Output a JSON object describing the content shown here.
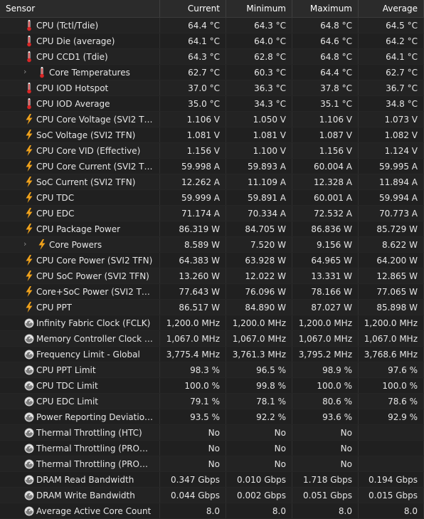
{
  "columns": {
    "sensor": "Sensor",
    "current": "Current",
    "minimum": "Minimum",
    "maximum": "Maximum",
    "average": "Average"
  },
  "rows": [
    {
      "name": "CPU (Tctl/Tdie)",
      "icon": "thermometer-icon",
      "current": "64.4 °C",
      "min": "64.3 °C",
      "max": "64.8 °C",
      "avg": "64.5 °C",
      "group": false
    },
    {
      "name": "CPU Die (average)",
      "icon": "thermometer-icon",
      "current": "64.1 °C",
      "min": "64.0 °C",
      "max": "64.6 °C",
      "avg": "64.2 °C",
      "group": false
    },
    {
      "name": "CPU CCD1 (Tdie)",
      "icon": "thermometer-icon",
      "current": "64.3 °C",
      "min": "62.8 °C",
      "max": "64.8 °C",
      "avg": "64.1 °C",
      "group": false
    },
    {
      "name": "Core Temperatures",
      "icon": "thermometer-icon",
      "current": "62.7 °C",
      "min": "60.3 °C",
      "max": "64.4 °C",
      "avg": "62.7 °C",
      "group": true
    },
    {
      "name": "CPU IOD Hotspot",
      "icon": "thermometer-icon",
      "current": "37.0 °C",
      "min": "36.3 °C",
      "max": "37.8 °C",
      "avg": "36.7 °C",
      "group": false
    },
    {
      "name": "CPU IOD Average",
      "icon": "thermometer-icon",
      "current": "35.0 °C",
      "min": "34.3 °C",
      "max": "35.1 °C",
      "avg": "34.8 °C",
      "group": false
    },
    {
      "name": "CPU Core Voltage (SVI2 TFN)",
      "icon": "lightning-icon",
      "current": "1.106 V",
      "min": "1.050 V",
      "max": "1.106 V",
      "avg": "1.073 V",
      "group": false
    },
    {
      "name": "SoC Voltage (SVI2 TFN)",
      "icon": "lightning-icon",
      "current": "1.081 V",
      "min": "1.081 V",
      "max": "1.087 V",
      "avg": "1.082 V",
      "group": false
    },
    {
      "name": "CPU Core VID (Effective)",
      "icon": "lightning-icon",
      "current": "1.156 V",
      "min": "1.100 V",
      "max": "1.156 V",
      "avg": "1.124 V",
      "group": false
    },
    {
      "name": "CPU Core Current (SVI2 TFN)",
      "icon": "lightning-icon",
      "current": "59.998 A",
      "min": "59.893 A",
      "max": "60.004 A",
      "avg": "59.995 A",
      "group": false
    },
    {
      "name": "SoC Current (SVI2 TFN)",
      "icon": "lightning-icon",
      "current": "12.262 A",
      "min": "11.109 A",
      "max": "12.328 A",
      "avg": "11.894 A",
      "group": false
    },
    {
      "name": "CPU TDC",
      "icon": "lightning-icon",
      "current": "59.999 A",
      "min": "59.891 A",
      "max": "60.001 A",
      "avg": "59.994 A",
      "group": false
    },
    {
      "name": "CPU EDC",
      "icon": "lightning-icon",
      "current": "71.174 A",
      "min": "70.334 A",
      "max": "72.532 A",
      "avg": "70.773 A",
      "group": false
    },
    {
      "name": "CPU Package Power",
      "icon": "lightning-icon",
      "current": "86.319 W",
      "min": "84.705 W",
      "max": "86.836 W",
      "avg": "85.729 W",
      "group": false
    },
    {
      "name": "Core Powers",
      "icon": "lightning-icon",
      "current": "8.589 W",
      "min": "7.520 W",
      "max": "9.156 W",
      "avg": "8.622 W",
      "group": true
    },
    {
      "name": "CPU Core Power (SVI2 TFN)",
      "icon": "lightning-icon",
      "current": "64.383 W",
      "min": "63.928 W",
      "max": "64.965 W",
      "avg": "64.200 W",
      "group": false
    },
    {
      "name": "CPU SoC Power (SVI2 TFN)",
      "icon": "lightning-icon",
      "current": "13.260 W",
      "min": "12.022 W",
      "max": "13.331 W",
      "avg": "12.865 W",
      "group": false
    },
    {
      "name": "Core+SoC Power (SVI2 TFN)",
      "icon": "lightning-icon",
      "current": "77.643 W",
      "min": "76.096 W",
      "max": "78.166 W",
      "avg": "77.065 W",
      "group": false
    },
    {
      "name": "CPU PPT",
      "icon": "lightning-icon",
      "current": "86.517 W",
      "min": "84.890 W",
      "max": "87.027 W",
      "avg": "85.898 W",
      "group": false
    },
    {
      "name": "Infinity Fabric Clock (FCLK)",
      "icon": "gauge-icon",
      "current": "1,200.0 MHz",
      "min": "1,200.0 MHz",
      "max": "1,200.0 MHz",
      "avg": "1,200.0 MHz",
      "group": false
    },
    {
      "name": "Memory Controller Clock (U...",
      "icon": "gauge-icon",
      "current": "1,067.0 MHz",
      "min": "1,067.0 MHz",
      "max": "1,067.0 MHz",
      "avg": "1,067.0 MHz",
      "group": false
    },
    {
      "name": "Frequency Limit - Global",
      "icon": "gauge-icon",
      "current": "3,775.4 MHz",
      "min": "3,761.3 MHz",
      "max": "3,795.2 MHz",
      "avg": "3,768.6 MHz",
      "group": false
    },
    {
      "name": "CPU PPT Limit",
      "icon": "gauge-icon",
      "current": "98.3 %",
      "min": "96.5 %",
      "max": "98.9 %",
      "avg": "97.6 %",
      "group": false
    },
    {
      "name": "CPU TDC Limit",
      "icon": "gauge-icon",
      "current": "100.0 %",
      "min": "99.8 %",
      "max": "100.0 %",
      "avg": "100.0 %",
      "group": false
    },
    {
      "name": "CPU EDC Limit",
      "icon": "gauge-icon",
      "current": "79.1 %",
      "min": "78.1 %",
      "max": "80.6 %",
      "avg": "78.6 %",
      "group": false
    },
    {
      "name": "Power Reporting Deviation ...",
      "icon": "gauge-icon",
      "current": "93.5 %",
      "min": "92.2 %",
      "max": "93.6 %",
      "avg": "92.9 %",
      "group": false
    },
    {
      "name": "Thermal Throttling (HTC)",
      "icon": "gauge-icon",
      "current": "No",
      "min": "No",
      "max": "No",
      "avg": "",
      "group": false
    },
    {
      "name": "Thermal Throttling (PROCH...",
      "icon": "gauge-icon",
      "current": "No",
      "min": "No",
      "max": "No",
      "avg": "",
      "group": false
    },
    {
      "name": "Thermal Throttling (PROCH...",
      "icon": "gauge-icon",
      "current": "No",
      "min": "No",
      "max": "No",
      "avg": "",
      "group": false
    },
    {
      "name": "DRAM Read Bandwidth",
      "icon": "gauge-icon",
      "current": "0.347 Gbps",
      "min": "0.010 Gbps",
      "max": "1.718 Gbps",
      "avg": "0.194 Gbps",
      "group": false
    },
    {
      "name": "DRAM Write Bandwidth",
      "icon": "gauge-icon",
      "current": "0.044 Gbps",
      "min": "0.002 Gbps",
      "max": "0.051 Gbps",
      "avg": "0.015 Gbps",
      "group": false
    },
    {
      "name": "Average Active Core Count",
      "icon": "gauge-icon",
      "current": "8.0",
      "min": "8.0",
      "max": "8.0",
      "avg": "8.0",
      "group": false
    }
  ],
  "colors": {
    "thermometer": "#d92626",
    "lightning": "#f0a21b",
    "gauge": "#cfcfcf"
  }
}
